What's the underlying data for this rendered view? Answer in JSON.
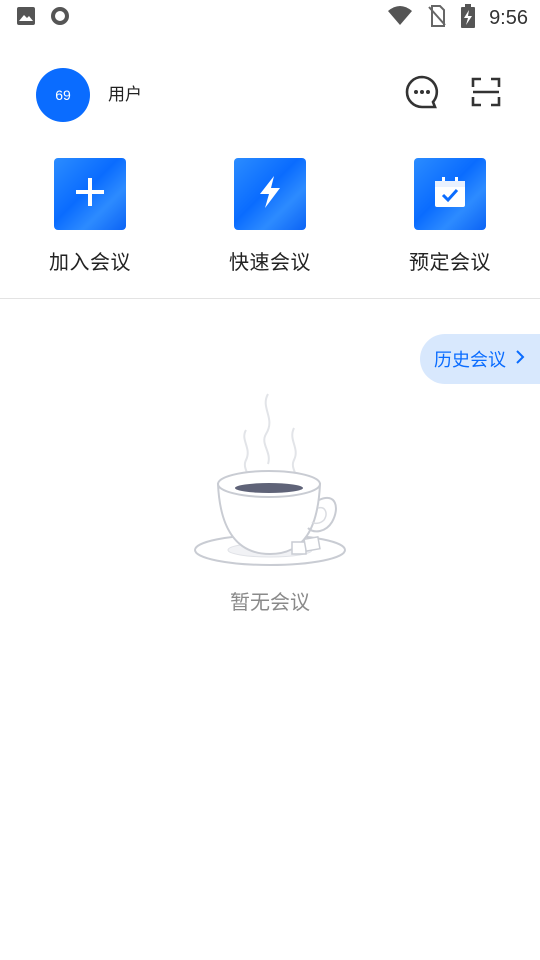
{
  "status_bar": {
    "time": "9:56",
    "icons": [
      "image-icon",
      "sync-ring-icon",
      "wifi-icon",
      "no-sim-icon",
      "battery-charging-icon"
    ]
  },
  "header": {
    "avatar_text": "69",
    "username": "用户",
    "icons": [
      "message-icon",
      "scan-icon"
    ]
  },
  "actions": [
    {
      "label": "加入会议",
      "icon": "plus-icon"
    },
    {
      "label": "快速会议",
      "icon": "lightning-icon"
    },
    {
      "label": "预定会议",
      "icon": "calendar-check-icon"
    }
  ],
  "history_button": {
    "label": "历史会议",
    "icon": "chevron-right-icon"
  },
  "empty_state": {
    "text": "暂无会议",
    "illustration": "coffee-cup-icon"
  },
  "colors": {
    "accent": "#0a6cff",
    "history_bg": "#d8e8fd",
    "muted_text": "#8a8a8a",
    "divider": "#e3e3e3"
  }
}
